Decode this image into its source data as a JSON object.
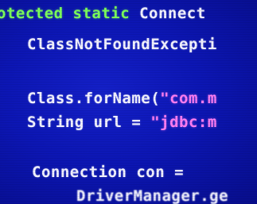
{
  "code": {
    "line1": {
      "keyword": "otected static",
      "rest": " Connect"
    },
    "line2": {
      "text": "ClassNotFoundExcepti"
    },
    "line3": {
      "text": "Class.forName(",
      "string": "\"com.m"
    },
    "line4": {
      "text": "String url = ",
      "string": "\"jdbc:m"
    },
    "line5": {
      "text": "Connection con ="
    },
    "line6": {
      "text": "DriverManager.ge"
    }
  },
  "colors": {
    "background": "#0c16b4",
    "keyword": "#7cff5a",
    "text": "#f2f2ff",
    "string": "#ff7ef2"
  }
}
